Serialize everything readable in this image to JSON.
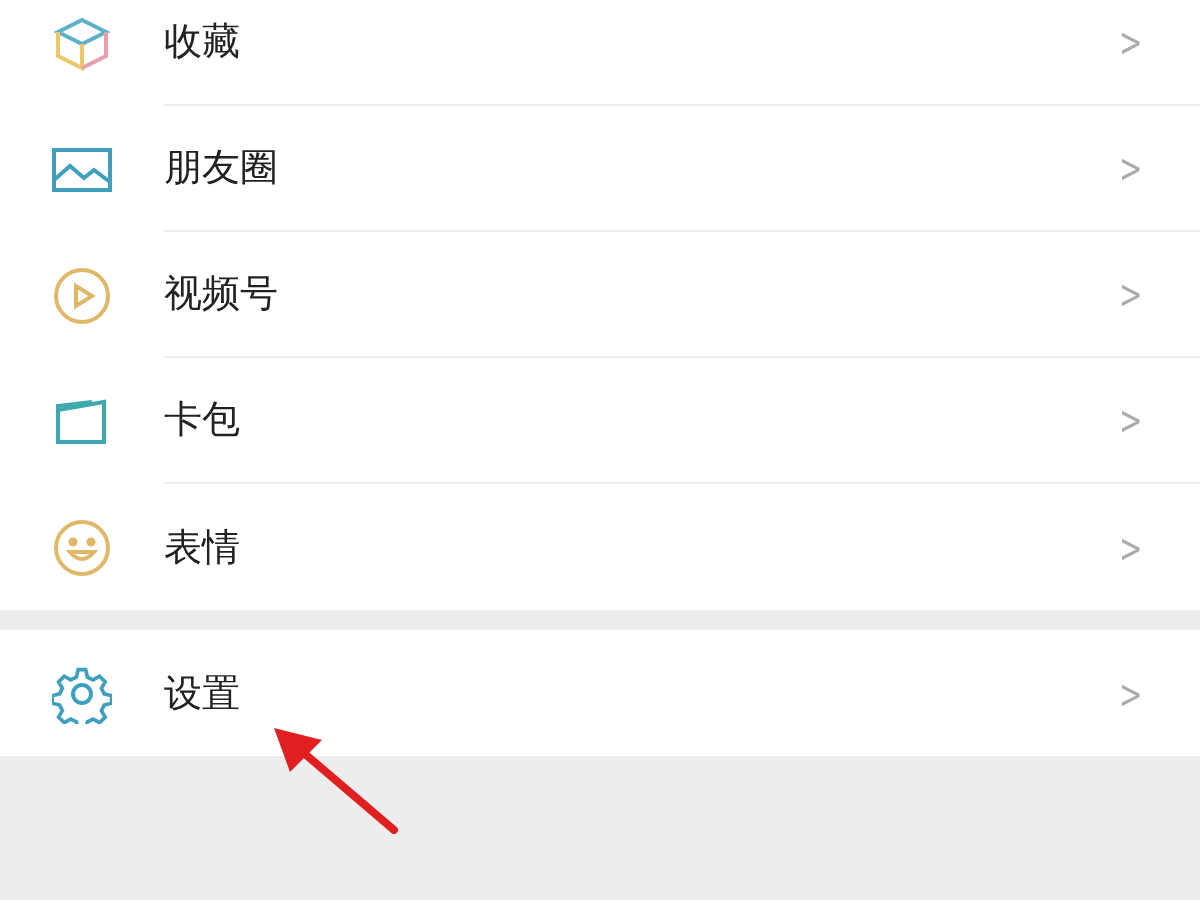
{
  "menu_groups": [
    {
      "items": [
        {
          "kind": "cube",
          "label": "收藏",
          "chevron": ">"
        },
        {
          "kind": "picture",
          "label": "朋友圈",
          "chevron": ">"
        },
        {
          "kind": "play",
          "label": "视频号",
          "chevron": ">"
        },
        {
          "kind": "card",
          "label": "卡包",
          "chevron": ">"
        },
        {
          "kind": "smile",
          "label": "表情",
          "chevron": ">"
        }
      ]
    },
    {
      "items": [
        {
          "kind": "gear",
          "label": "设置",
          "chevron": ">"
        }
      ]
    }
  ],
  "annotation": {
    "kind": "arrow"
  }
}
